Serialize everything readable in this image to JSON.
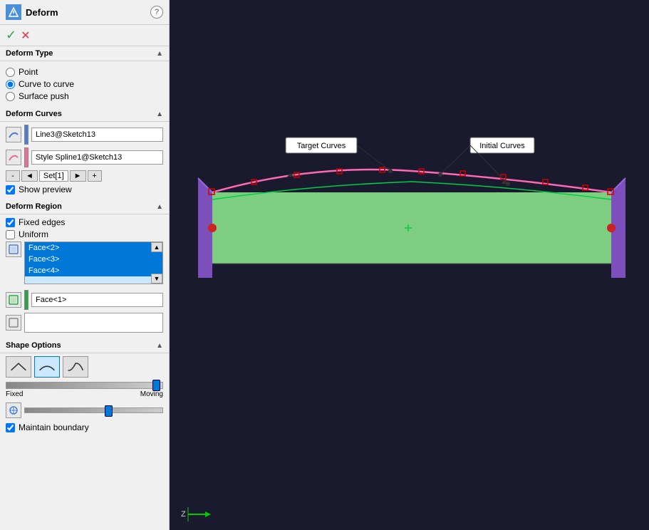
{
  "header": {
    "title": "Deform",
    "help_label": "?",
    "accept_symbol": "✓",
    "cancel_symbol": "✕"
  },
  "deform_type": {
    "label": "Deform Type",
    "options": [
      {
        "label": "Point",
        "value": "point",
        "checked": false
      },
      {
        "label": "Curve to curve",
        "value": "curve_to_curve",
        "checked": true
      },
      {
        "label": "Surface push",
        "value": "surface_push",
        "checked": false
      }
    ]
  },
  "deform_curves": {
    "label": "Deform Curves",
    "curves": [
      {
        "name": "Line3@Sketch13",
        "color": "#4a7fd4"
      },
      {
        "name": "Style Spline1@Sketch13",
        "color": "#e87090"
      }
    ],
    "set_controls": {
      "minus": "-",
      "arrow_left": "◄",
      "set_label": "Set[1]",
      "arrow_right": "►",
      "plus": "+"
    },
    "show_preview": {
      "label": "Show preview",
      "checked": true
    }
  },
  "deform_region": {
    "label": "Deform Region",
    "fixed_edges": {
      "label": "Fixed edges",
      "checked": true
    },
    "uniform": {
      "label": "Uniform",
      "checked": false
    },
    "face_list": [
      "Face<2>",
      "Face<3>",
      "Face<4>"
    ],
    "face_single": "Face<1>",
    "empty_field": ""
  },
  "shape_options": {
    "label": "Shape Options",
    "buttons": [
      {
        "symbol": "▲",
        "active": false
      },
      {
        "symbol": "▲",
        "active": true
      },
      {
        "symbol": "▲",
        "active": false
      }
    ],
    "slider1": {
      "left_label": "Fixed",
      "right_label": "Moving",
      "value": 95
    },
    "slider2": {
      "value": 60
    },
    "maintain_boundary": {
      "label": "Maintain boundary",
      "checked": true
    }
  },
  "viewport": {
    "target_curves_label": "Target Curves",
    "initial_curves_label": "Initial Curves",
    "axis_z": "Z"
  }
}
